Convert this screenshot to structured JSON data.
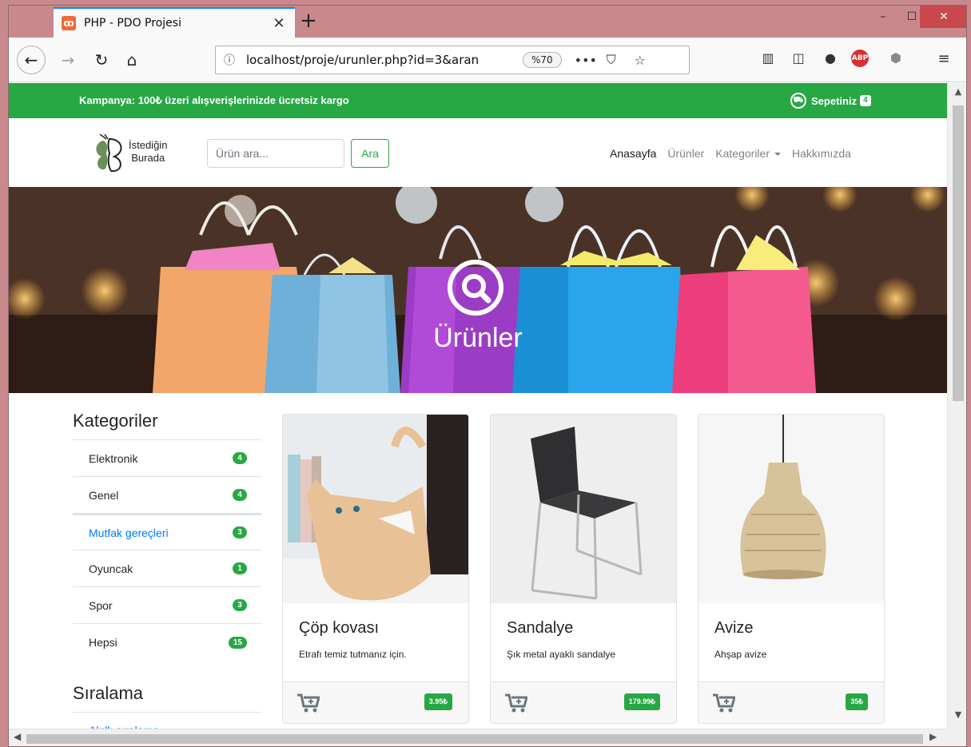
{
  "browser": {
    "tab_title": "PHP - PDO Projesi",
    "url": "localhost/proje/urunler.php?id=3&aran",
    "zoom": "%70",
    "more_label": "•••"
  },
  "promo": {
    "text": "Kampanya: 100₺ üzeri alışverişlerinizde ücretsiz kargo",
    "cart_label": "Sepetiniz",
    "cart_count": "4"
  },
  "header": {
    "logo_line1": "İstediğin",
    "logo_line2": "Burada",
    "search_placeholder": "Ürün ara...",
    "search_button": "Ara",
    "nav": [
      "Anasayfa",
      "Ürünler",
      "Kategoriler",
      "Hakkımızda"
    ]
  },
  "hero": {
    "title": "Ürünler"
  },
  "sidebar": {
    "categories_heading": "Kategoriler",
    "categories": [
      {
        "label": "Elektronik",
        "count": "4"
      },
      {
        "label": "Genel",
        "count": "4"
      },
      {
        "label": "Mutfak gereçleri",
        "count": "3"
      },
      {
        "label": "Oyuncak",
        "count": "1"
      },
      {
        "label": "Spor",
        "count": "3"
      },
      {
        "label": "Hepsi",
        "count": "15"
      }
    ],
    "sort_heading": "Sıralama",
    "sort_items": [
      "Akıllı sıralama"
    ]
  },
  "products": [
    {
      "title": "Çöp kovası",
      "description": "Etrafı temiz tutmanız için.",
      "price": "3.95₺"
    },
    {
      "title": "Sandalye",
      "description": "Şık metal ayaklı sandalye",
      "price": "179.99₺"
    },
    {
      "title": "Avize",
      "description": "Ahşap avize",
      "price": "35₺"
    }
  ],
  "colors": {
    "brand_green": "#28a745",
    "link_blue": "#007bff",
    "tab_accent": "#0a84ff"
  }
}
